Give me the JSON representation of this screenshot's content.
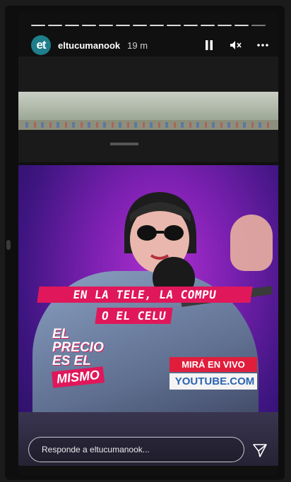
{
  "story": {
    "username": "eltucumanook",
    "time": "19 m",
    "avatar_text": "et",
    "progress_segments": 14,
    "progress_watched": 13
  },
  "overlay": {
    "line1": "EN LA TELE, LA COMPU",
    "line2": "O EL CELU",
    "sticker": [
      "EL",
      "PRECIO",
      "ES EL",
      "MISMO"
    ],
    "live_label": "MIRÁ EN VIVO",
    "site": "YOUTUBE.COM"
  },
  "reply": {
    "placeholder": "Responde a eltucumanook..."
  },
  "icons": {
    "pause": "pause-icon",
    "mute": "mute-icon",
    "more": "more-icon",
    "send": "send-icon",
    "link": "link-icon"
  },
  "colors": {
    "accent_pink": "#e0175a",
    "live_red": "#e01e3c",
    "avatar": "#1e7e8c"
  }
}
